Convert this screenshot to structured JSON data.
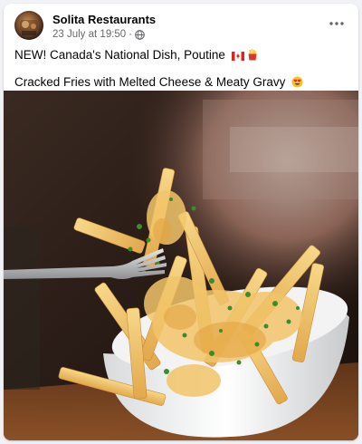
{
  "post": {
    "author": "Solita Restaurants",
    "date": "23 July at 19:50",
    "separator": "·",
    "audience_icon": "globe-icon",
    "more_icon": "more-options-icon",
    "line1": "NEW! Canada's National Dish, Poutine",
    "line1_emojis": [
      "canada-flag-emoji",
      "fries-emoji"
    ],
    "line2": "Cracked Fries with Melted Cheese & Meaty Gravy",
    "line2_emojis": [
      "heart-eyes-emoji"
    ],
    "photo": "poutine-photo"
  },
  "colors": {
    "name": "#050505",
    "meta": "#65676b",
    "background": "#f0f2f5",
    "card": "#ffffff"
  }
}
